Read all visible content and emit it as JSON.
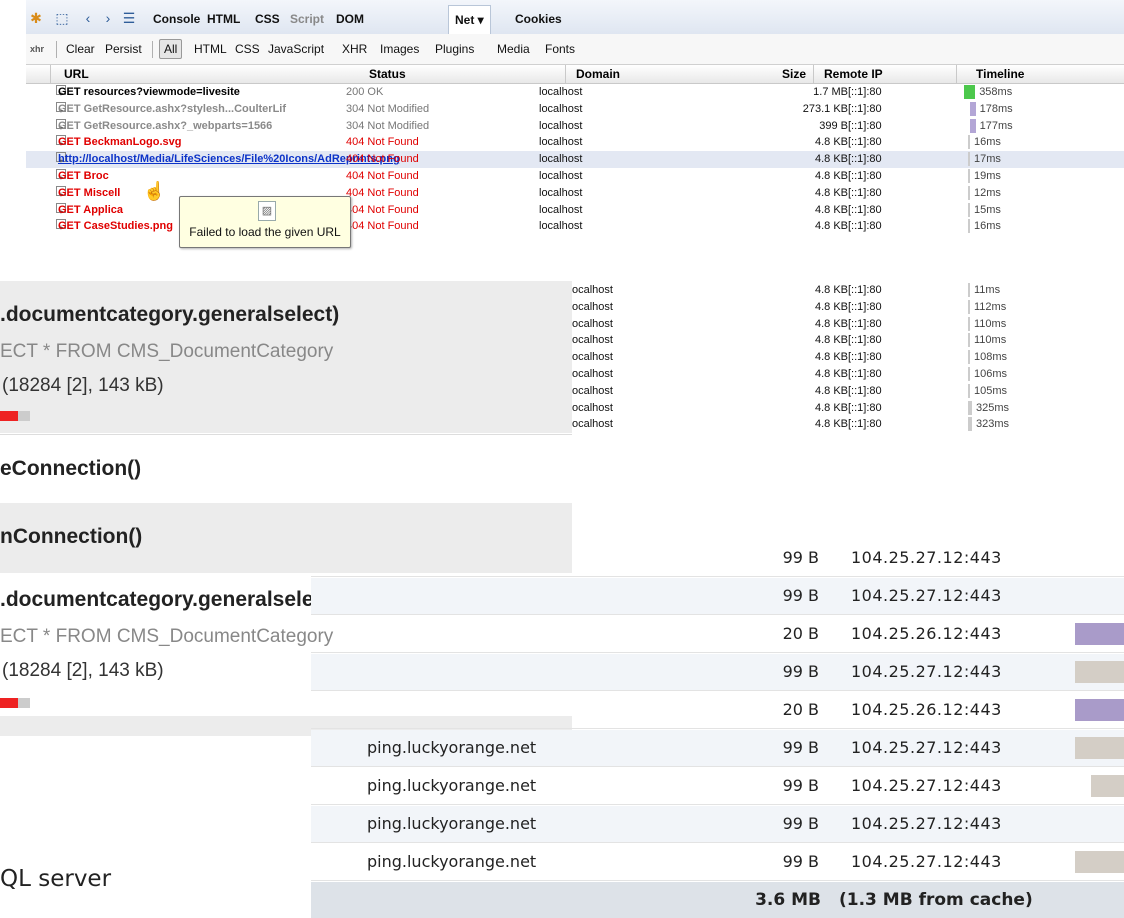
{
  "firebug": {
    "tabs": [
      "Console",
      "HTML",
      "CSS",
      "Script",
      "DOM",
      "Net ▾",
      "Cookies"
    ],
    "toolbar": {
      "icon_label": "xhr",
      "clear": "Clear",
      "persist": "Persist",
      "filters": [
        "All",
        "HTML",
        "CSS",
        "JavaScript",
        "XHR",
        "Images",
        "Plugins",
        "Media",
        "Fonts"
      ]
    },
    "columns": {
      "url": "URL",
      "status": "Status",
      "domain": "Domain",
      "size": "Size",
      "remote_ip": "Remote IP",
      "timeline": "Timeline"
    },
    "rows": [
      {
        "url": "GET resources?viewmode=livesite",
        "status": "200 OK",
        "domain": "localhost",
        "size": "1.7 MB",
        "ip": "[::1]:80",
        "time": "358ms",
        "state": "ok",
        "bar": "#4cc84c",
        "offset": 0.0,
        "fraction": 0.14
      },
      {
        "url": "GET GetResource.ashx?stylesh...CoulterLif",
        "status": "304 Not Modified",
        "domain": "localhost",
        "size": "273.1 KB",
        "ip": "[::1]:80",
        "time": "178ms",
        "state": "mod",
        "bar": "#b3a6d6",
        "offset": 0.3,
        "fraction": 0.07
      },
      {
        "url": "GET GetResource.ashx?_webparts=1566",
        "status": "304 Not Modified",
        "domain": "localhost",
        "size": "399 B",
        "ip": "[::1]:80",
        "time": "177ms",
        "state": "mod",
        "bar": "#b3a6d6",
        "offset": 0.3,
        "fraction": 0.07
      },
      {
        "url": "GET BeckmanLogo.svg",
        "status": "404 Not Found",
        "domain": "localhost",
        "size": "4.8 KB",
        "ip": "[::1]:80",
        "time": "16ms",
        "state": "err",
        "bar": "#cccccc",
        "offset": 0.2,
        "fraction": 0.01
      },
      {
        "url": "http://localhost/Media/LifeSciences/File%20Icons/AdReprints.png",
        "status": "404 Not Found",
        "domain": "localhost",
        "size": "4.8 KB",
        "ip": "[::1]:80",
        "time": "17ms",
        "state": "link",
        "bar": "#cccccc",
        "offset": 0.2,
        "fraction": 0.01
      },
      {
        "url": "GET Broc",
        "status": "404 Not Found",
        "domain": "localhost",
        "size": "4.8 KB",
        "ip": "[::1]:80",
        "time": "19ms",
        "state": "err",
        "bar": "#cccccc",
        "offset": 0.2,
        "fraction": 0.01
      },
      {
        "url": "GET Miscell",
        "status": "404 Not Found",
        "domain": "localhost",
        "size": "4.8 KB",
        "ip": "[::1]:80",
        "time": "12ms",
        "state": "err",
        "bar": "#cccccc",
        "offset": 0.2,
        "fraction": 0.01
      },
      {
        "url": "GET Applica",
        "status": "404 Not Found",
        "domain": "localhost",
        "size": "4.8 KB",
        "ip": "[::1]:80",
        "time": "15ms",
        "state": "err",
        "bar": "#cccccc",
        "offset": 0.2,
        "fraction": 0.01
      },
      {
        "url": "GET CaseStudies.png",
        "status": "404 Not Found",
        "domain": "localhost",
        "size": "4.8 KB",
        "ip": "[::1]:80",
        "time": "16ms",
        "state": "err",
        "bar": "#cccccc",
        "offset": 0.2,
        "fraction": 0.01
      }
    ],
    "tooltip": "Failed to load the given URL",
    "more_rows": [
      {
        "domain": "ocalhost",
        "size": "4.8 KB",
        "ip": "[::1]:80",
        "time": "11ms",
        "bar": "#cccccc",
        "offset": 0.2,
        "fraction": 0.01
      },
      {
        "domain": "ocalhost",
        "size": "4.8 KB",
        "ip": "[::1]:80",
        "time": "112ms",
        "bar": "#cccccc",
        "offset": 0.2,
        "fraction": 0.01
      },
      {
        "domain": "ocalhost",
        "size": "4.8 KB",
        "ip": "[::1]:80",
        "time": "110ms",
        "bar": "#cccccc",
        "offset": 0.2,
        "fraction": 0.01
      },
      {
        "domain": "ocalhost",
        "size": "4.8 KB",
        "ip": "[::1]:80",
        "time": "110ms",
        "bar": "#cccccc",
        "offset": 0.2,
        "fraction": 0.01
      },
      {
        "domain": "ocalhost",
        "size": "4.8 KB",
        "ip": "[::1]:80",
        "time": "108ms",
        "bar": "#cccccc",
        "offset": 0.2,
        "fraction": 0.01
      },
      {
        "domain": "ocalhost",
        "size": "4.8 KB",
        "ip": "[::1]:80",
        "time": "106ms",
        "bar": "#cccccc",
        "offset": 0.2,
        "fraction": 0.01
      },
      {
        "domain": "ocalhost",
        "size": "4.8 KB",
        "ip": "[::1]:80",
        "time": "105ms",
        "bar": "#cccccc",
        "offset": 0.2,
        "fraction": 0.01
      },
      {
        "domain": "ocalhost",
        "size": "4.8 KB",
        "ip": "[::1]:80",
        "time": "325ms",
        "bar": "#cccccc",
        "offset": 0.2,
        "fraction": 0.05
      },
      {
        "domain": "ocalhost",
        "size": "4.8 KB",
        "ip": "[::1]:80",
        "time": "323ms",
        "bar": "#cccccc",
        "offset": 0.2,
        "fraction": 0.05
      }
    ]
  },
  "sql": {
    "blocks": [
      {
        "title": ".documentcategory.generalselect)",
        "query": "ECT * FROM CMS_DocumentCategory",
        "info": "(18284 [2], 143 kB)",
        "bar_fraction": 0.6
      },
      {
        "title": "eConnection()"
      },
      {
        "title": "nConnection()"
      },
      {
        "title": ".documentcategory.generalselect)",
        "query": "ECT * FROM CMS_DocumentCategory",
        "info": "(18284 [2], 143 kB)",
        "bar_fraction": 0.6
      }
    ]
  },
  "chrome_net": {
    "rows": [
      {
        "domain": "",
        "size": "99 B",
        "ip": "104.25.27.12:443",
        "bar": "",
        "offset": 0,
        "fraction": 0
      },
      {
        "domain": "",
        "size": "99 B",
        "ip": "104.25.27.12:443",
        "bar": "",
        "offset": 0,
        "fraction": 0
      },
      {
        "domain": "",
        "size": "20 B",
        "ip": "104.25.26.12:443",
        "bar": "#a99bc9",
        "offset": 0.94,
        "fraction": 0.06
      },
      {
        "domain": "",
        "size": "99 B",
        "ip": "104.25.27.12:443",
        "bar": "#d4cec6",
        "offset": 0.94,
        "fraction": 0.06
      },
      {
        "domain": "",
        "size": "20 B",
        "ip": "104.25.26.12:443",
        "bar": "#a99bc9",
        "offset": 0.94,
        "fraction": 0.06
      },
      {
        "domain": "ping.luckyorange.net",
        "size": "99 B",
        "ip": "104.25.27.12:443",
        "bar": "#d4cec6",
        "offset": 0.94,
        "fraction": 0.06
      },
      {
        "domain": "ping.luckyorange.net",
        "size": "99 B",
        "ip": "104.25.27.12:443",
        "bar": "#d4cec6",
        "offset": 0.96,
        "fraction": 0.04
      },
      {
        "domain": "ping.luckyorange.net",
        "size": "99 B",
        "ip": "104.25.27.12:443",
        "bar": "",
        "offset": 0,
        "fraction": 0
      },
      {
        "domain": "ping.luckyorange.net",
        "size": "99 B",
        "ip": "104.25.27.12:443",
        "bar": "#d4cec6",
        "offset": 0.94,
        "fraction": 0.06
      }
    ],
    "total_size": "3.6 MB",
    "from_cache": "(1.3 MB from cache)"
  },
  "caption": "QL server"
}
